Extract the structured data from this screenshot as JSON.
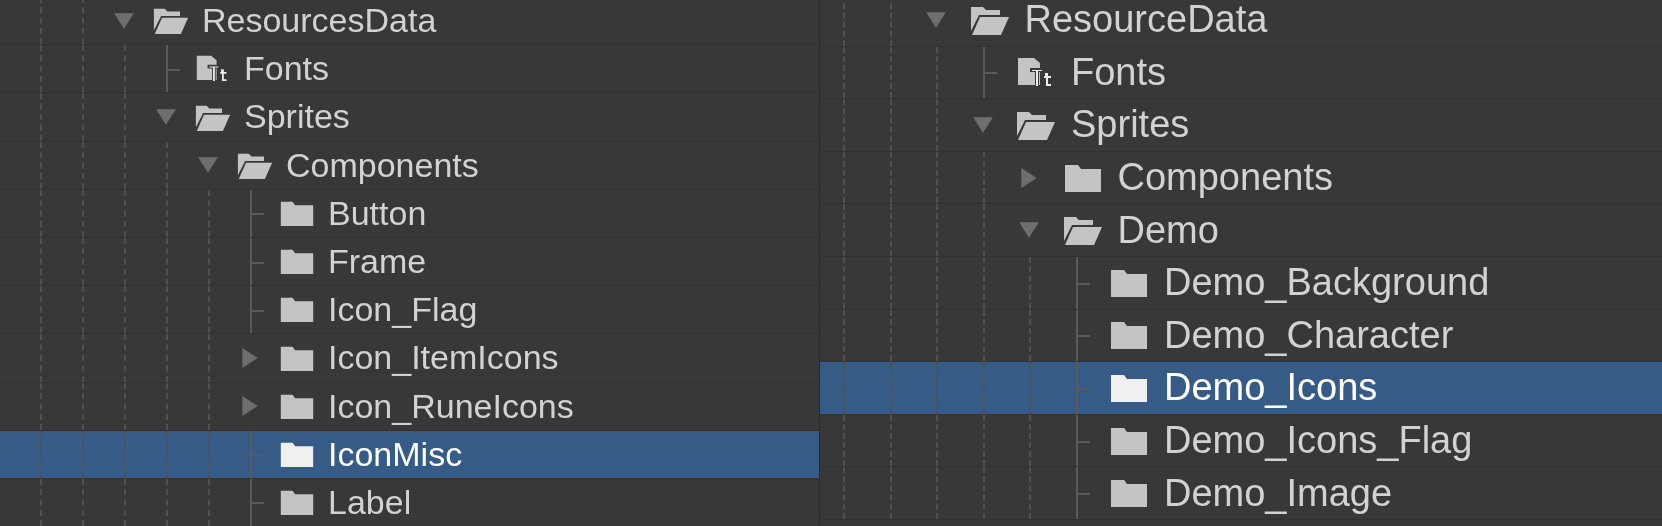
{
  "panels": [
    {
      "tree": [
        {
          "name": "ResourcesData",
          "kind": "folder",
          "expanded": true,
          "selected": false,
          "children": [
            {
              "name": "Fonts",
              "kind": "font",
              "selected": false
            },
            {
              "name": "Sprites",
              "kind": "folder",
              "expanded": true,
              "selected": false,
              "children": [
                {
                  "name": "Components",
                  "kind": "folder",
                  "expanded": true,
                  "selected": false,
                  "children": [
                    {
                      "name": "Button",
                      "kind": "folder",
                      "selected": false
                    },
                    {
                      "name": "Frame",
                      "kind": "folder",
                      "selected": false
                    },
                    {
                      "name": "Icon_Flag",
                      "kind": "folder",
                      "selected": false
                    },
                    {
                      "name": "Icon_ItemIcons",
                      "kind": "folder",
                      "expanded": false,
                      "selected": false
                    },
                    {
                      "name": "Icon_RuneIcons",
                      "kind": "folder",
                      "expanded": false,
                      "selected": false
                    },
                    {
                      "name": "IconMisc",
                      "kind": "folder",
                      "selected": true
                    },
                    {
                      "name": "Label",
                      "kind": "folder",
                      "selected": false
                    }
                  ]
                }
              ]
            }
          ]
        }
      ]
    },
    {
      "tree": [
        {
          "name": "ResourceData",
          "kind": "folder",
          "expanded": true,
          "selected": false,
          "children": [
            {
              "name": "Fonts",
              "kind": "font",
              "selected": false
            },
            {
              "name": "Sprites",
              "kind": "folder",
              "expanded": true,
              "selected": false,
              "children": [
                {
                  "name": "Components",
                  "kind": "folder",
                  "expanded": false,
                  "selected": false
                },
                {
                  "name": "Demo",
                  "kind": "folder",
                  "expanded": true,
                  "selected": false,
                  "children": [
                    {
                      "name": "Demo_Background",
                      "kind": "folder",
                      "selected": false
                    },
                    {
                      "name": "Demo_Character",
                      "kind": "folder",
                      "selected": false
                    },
                    {
                      "name": "Demo_Icons",
                      "kind": "folder",
                      "selected": true
                    },
                    {
                      "name": "Demo_Icons_Flag",
                      "kind": "folder",
                      "selected": false
                    },
                    {
                      "name": "Demo_Image",
                      "kind": "folder",
                      "selected": false
                    }
                  ]
                }
              ]
            }
          ]
        }
      ]
    }
  ]
}
